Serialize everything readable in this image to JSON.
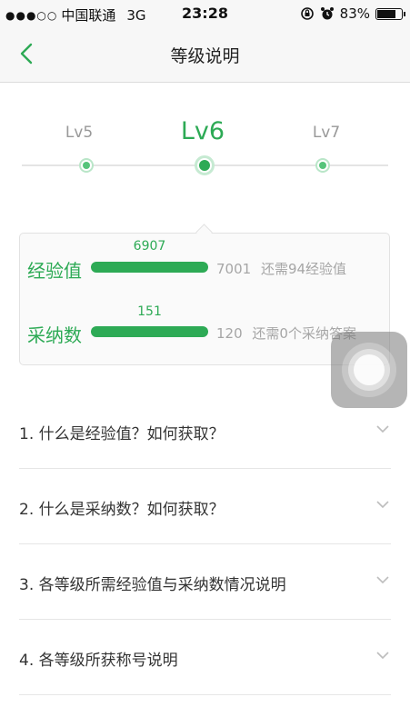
{
  "status_bar": {
    "carrier": "中国联通",
    "network": "3G",
    "time": "23:28",
    "battery": "83%",
    "battery_level": 0.83
  },
  "nav": {
    "title": "等级说明"
  },
  "levels": {
    "prev": "Lv5",
    "current": "Lv6",
    "next": "Lv7"
  },
  "metrics": [
    {
      "label": "经验值",
      "value": "6907",
      "target": "7001",
      "hint": "还需94经验值"
    },
    {
      "label": "采纳数",
      "value": "151",
      "target": "120",
      "hint": "还需0个采纳答案"
    }
  ],
  "faq": [
    {
      "text": "1. 什么是经验值？如何获取？"
    },
    {
      "text": "2. 什么是采纳数？如何获取？"
    },
    {
      "text": "3. 各等级所需经验值与采纳数情况说明"
    },
    {
      "text": "4. 各等级所获称号说明"
    }
  ],
  "colors": {
    "accent": "#2daa55",
    "muted": "#a6a6a6"
  }
}
